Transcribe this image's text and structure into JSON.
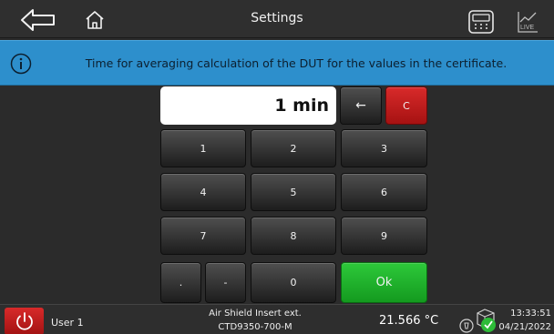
{
  "header": {
    "title": "Settings",
    "icons": [
      "back-arrow-icon",
      "home-icon",
      "calculator-icon",
      "live-chart-icon"
    ],
    "live_label": "LIVE"
  },
  "info": {
    "icon": "info-icon",
    "message": "Time for averaging calculation of the DUT for the values in the certificate."
  },
  "keypad": {
    "display_value": "1 min",
    "backspace": "←",
    "clear": "C",
    "digits": [
      "1",
      "2",
      "3",
      "4",
      "5",
      "6",
      "7",
      "8",
      "9"
    ],
    "dot": ".",
    "minus": "-",
    "zero": "0",
    "ok": "Ok",
    "colors": {
      "clear": "#c21c1c",
      "ok": "#1fb52b"
    }
  },
  "status": {
    "power_icon": "power-icon",
    "user": "User 1",
    "probe_line1": "Air Shield Insert ext.",
    "probe_line2": "CTD9350-700-M",
    "temperature": "21.566 °C",
    "time": "13:33:51",
    "date": "04/21/2022"
  }
}
